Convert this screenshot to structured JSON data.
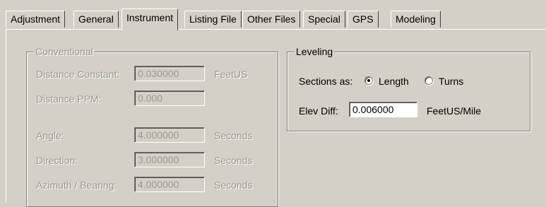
{
  "tabs": [
    "Adjustment",
    "General",
    "Instrument",
    "Listing File",
    "Other Files",
    "Special",
    "GPS",
    "Modeling"
  ],
  "active_tab": "Instrument",
  "conventional": {
    "title": "Conventional",
    "distance_constant": {
      "label": "Distance Constant:",
      "value": "0.030000",
      "unit": "FeetUS"
    },
    "distance_ppm": {
      "label": "Distance PPM:",
      "value": "0.000"
    },
    "angle": {
      "label": "Angle:",
      "value": "4.000000",
      "unit": "Seconds"
    },
    "direction": {
      "label": "Direction:",
      "value": "3.000000",
      "unit": "Seconds"
    },
    "azimuth_bearing": {
      "label": "Azimuth / Bearing:",
      "value": "4.000000",
      "unit": "Seconds"
    }
  },
  "leveling": {
    "title": "Leveling",
    "sections_as_label": "Sections as:",
    "option_length": "Length",
    "option_turns": "Turns",
    "selected": "Length",
    "elev_diff_label": "Elev Diff:",
    "elev_diff_value": "0.006000",
    "elev_diff_unit": "FeetUS/Mile"
  }
}
